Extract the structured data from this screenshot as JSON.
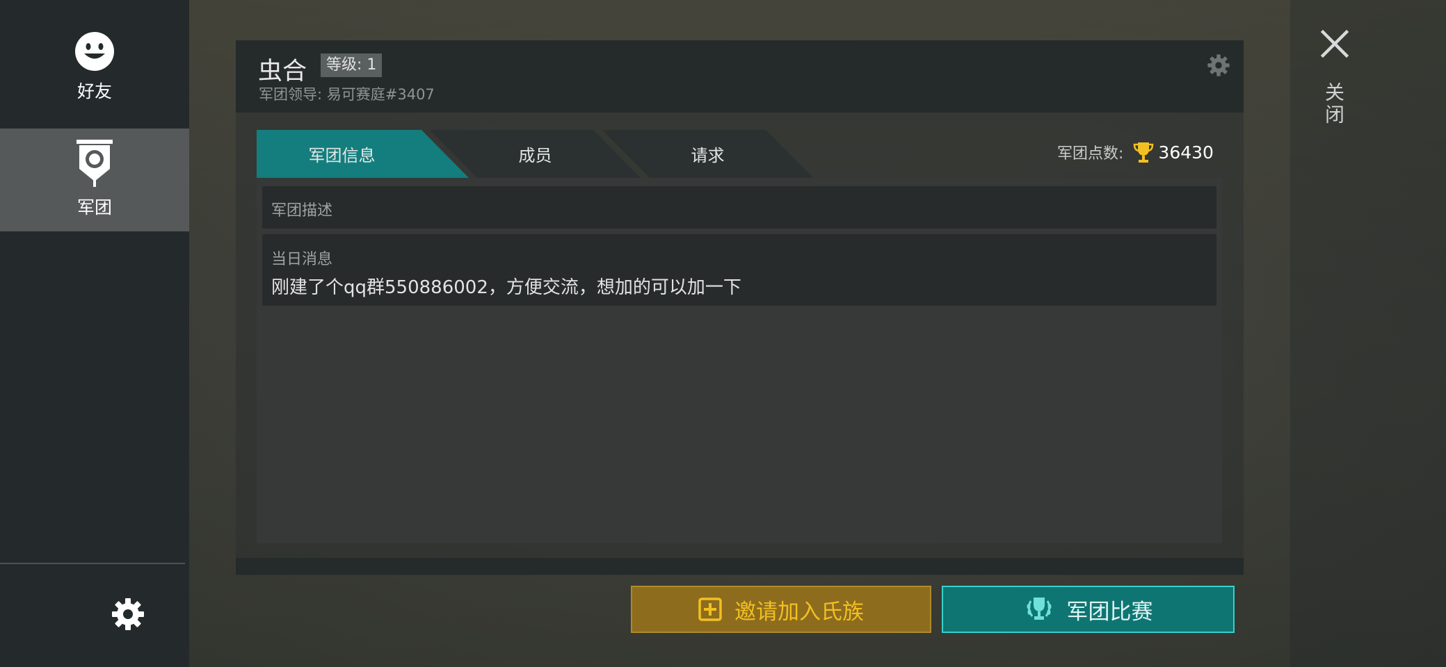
{
  "sidebar": {
    "items": [
      {
        "label": "好友",
        "icon": "smiley-icon"
      },
      {
        "label": "军团",
        "icon": "legion-banner-icon"
      }
    ],
    "settings_icon": "gear-icon"
  },
  "header": {
    "clan_name": "虫合",
    "level": "等级: 1",
    "leader": "军团领导: 易可赛庭#3407",
    "settings_icon": "gear-icon"
  },
  "tabs": [
    {
      "label": "军团信息",
      "active": true
    },
    {
      "label": "成员",
      "active": false
    },
    {
      "label": "请求",
      "active": false
    }
  ],
  "points": {
    "label": "军团点数:",
    "value": "36430",
    "icon": "trophy-icon"
  },
  "content": {
    "description_label": "军团描述",
    "message_label": "当日消息",
    "message_text": "刚建了个qq群550886002，方便交流，想加的可以加一下"
  },
  "buttons": {
    "invite": "邀请加入氏族",
    "contest": "军团比赛"
  },
  "close": {
    "label": "关闭"
  },
  "colors": {
    "accent_teal": "#137e7d",
    "invite_gold": "#f2c020",
    "sidebar_bg": "#242a2b"
  }
}
